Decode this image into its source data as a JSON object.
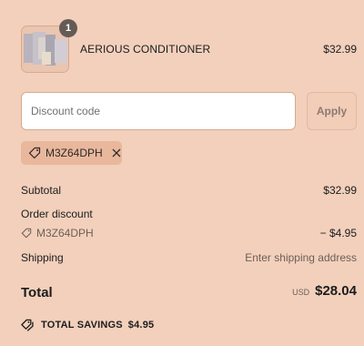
{
  "product": {
    "name": "AERIOUS CONDITIONER",
    "price": "$32.99",
    "quantity": "1"
  },
  "discount": {
    "placeholder": "Discount code",
    "apply_label": "Apply",
    "applied_code": "M3Z64DPH"
  },
  "summary": {
    "subtotal_label": "Subtotal",
    "subtotal_value": "$32.99",
    "order_discount_label": "Order discount",
    "discount_code": "M3Z64DPH",
    "discount_value": "− $4.95",
    "shipping_label": "Shipping",
    "shipping_value": "Enter shipping address",
    "total_label": "Total",
    "currency": "USD",
    "total_value": "$28.04",
    "savings_label": "TOTAL SAVINGS",
    "savings_value": "$4.95"
  },
  "icons": {
    "tag": "tag-icon",
    "remove": "close-icon",
    "savings": "tags-icon"
  },
  "colors": {
    "background": "#f2d0bc",
    "chip": "#e9b79c",
    "badge": "#655b56"
  }
}
